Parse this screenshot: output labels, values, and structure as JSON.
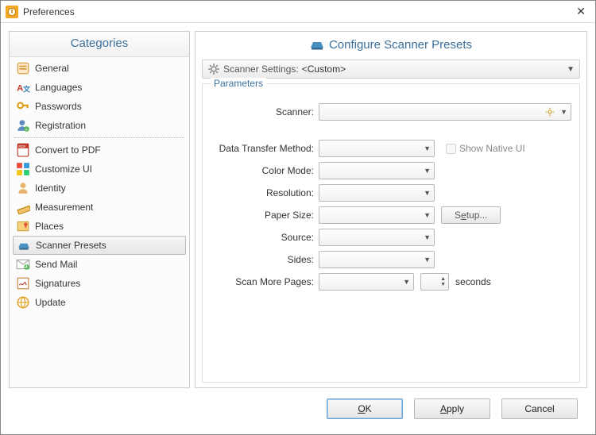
{
  "window": {
    "title": "Preferences"
  },
  "sidebar": {
    "header": "Categories",
    "items": [
      {
        "label": "General"
      },
      {
        "label": "Languages"
      },
      {
        "label": "Passwords"
      },
      {
        "label": "Registration"
      },
      {
        "label": "Convert to PDF"
      },
      {
        "label": "Customize UI"
      },
      {
        "label": "Identity"
      },
      {
        "label": "Measurement"
      },
      {
        "label": "Places"
      },
      {
        "label": "Scanner Presets"
      },
      {
        "label": "Send Mail"
      },
      {
        "label": "Signatures"
      },
      {
        "label": "Update"
      }
    ]
  },
  "main": {
    "header": "Configure Scanner Presets",
    "settings_label": "Scanner Settings:",
    "settings_value": "<Custom>",
    "group_title": "Parameters",
    "rows": {
      "scanner": "Scanner:",
      "dtm": "Data Transfer Method:",
      "show_native": "Show Native UI",
      "color": "Color Mode:",
      "resolution": "Resolution:",
      "paper": "Paper Size:",
      "setup_prefix": "S",
      "setup_u": "e",
      "setup_suffix": "tup...",
      "source": "Source:",
      "sides": "Sides:",
      "scan_more": "Scan More Pages:",
      "unit": "seconds"
    }
  },
  "footer": {
    "ok_u": "O",
    "ok_suffix": "K",
    "apply_u": "A",
    "apply_suffix": "pply",
    "cancel": "Cancel"
  }
}
